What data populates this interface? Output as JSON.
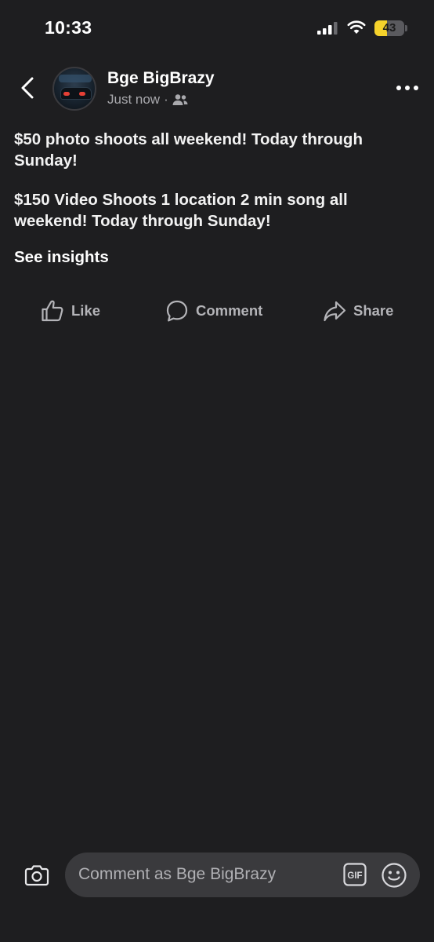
{
  "status_bar": {
    "time": "10:33",
    "battery_percent": "43",
    "battery_level": 0.43,
    "battery_color": "#f5d22b",
    "icons": [
      "cellular-signal-icon",
      "wifi-icon",
      "battery-icon"
    ]
  },
  "header": {
    "back_icon": "chevron-left-icon",
    "author": "Bge BigBrazy",
    "timestamp": "Just now",
    "separator": "·",
    "audience_icon": "friends-icon",
    "more_icon": "more-horizontal-icon"
  },
  "post": {
    "paragraphs": [
      "$50 photo shoots all weekend! Today through Sunday!",
      "$150 Video Shoots 1 location 2 min song all weekend! Today through Sunday!"
    ],
    "insights_label": "See insights"
  },
  "actions": {
    "like": "Like",
    "comment": "Comment",
    "share": "Share"
  },
  "composer": {
    "placeholder": "Comment as Bge BigBrazy",
    "gif_label": "GIF",
    "icons": [
      "camera-icon",
      "gif-icon",
      "emoji-icon"
    ]
  },
  "colors": {
    "background": "#1e1e20",
    "text": "#f2f2f2",
    "secondary_text": "#a9a9ad",
    "input_background": "#3a3a3d"
  }
}
